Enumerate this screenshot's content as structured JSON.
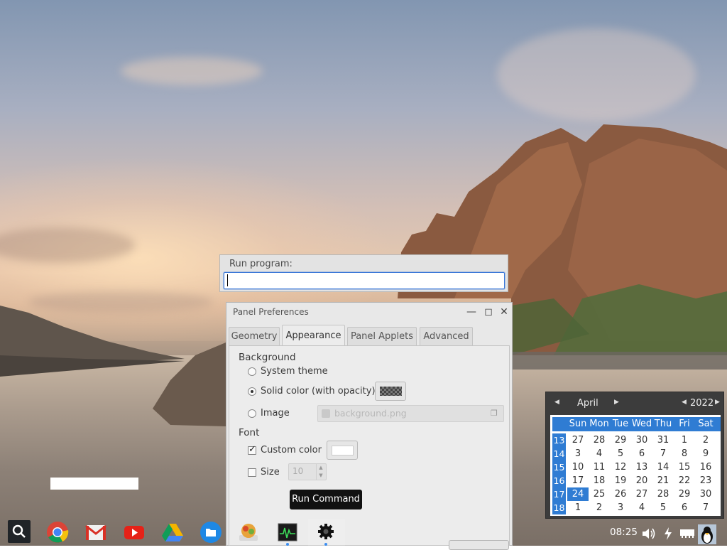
{
  "run_dialog": {
    "label": "Run program:",
    "value": ""
  },
  "prefs": {
    "title": "Panel Preferences",
    "tabs": [
      "Geometry",
      "Appearance",
      "Panel Applets",
      "Advanced"
    ],
    "active_tab": "Appearance",
    "background": {
      "heading": "Background",
      "options": [
        "System theme",
        "Solid color (with opacity)",
        "Image"
      ],
      "selected": "Solid color (with opacity)",
      "image_file": "background.png"
    },
    "font": {
      "heading": "Font",
      "custom_color_label": "Custom color",
      "custom_color_checked": true,
      "size_label": "Size",
      "size_checked": false,
      "size_value": "10"
    }
  },
  "tooltip": "Run Command",
  "calendar": {
    "month": "April",
    "year": "2022",
    "days_of_week": [
      "Sun",
      "Mon",
      "Tue",
      "Wed",
      "Thu",
      "Fri",
      "Sat"
    ],
    "weeks": [
      {
        "num": "13",
        "days": [
          "27",
          "28",
          "29",
          "30",
          "31",
          "1",
          "2"
        ]
      },
      {
        "num": "14",
        "days": [
          "3",
          "4",
          "5",
          "6",
          "7",
          "8",
          "9"
        ]
      },
      {
        "num": "15",
        "days": [
          "10",
          "11",
          "12",
          "13",
          "14",
          "15",
          "16"
        ]
      },
      {
        "num": "16",
        "days": [
          "17",
          "18",
          "19",
          "20",
          "21",
          "22",
          "23"
        ]
      },
      {
        "num": "17",
        "days": [
          "24",
          "25",
          "26",
          "27",
          "28",
          "29",
          "30"
        ]
      },
      {
        "num": "18",
        "days": [
          "1",
          "2",
          "3",
          "4",
          "5",
          "6",
          "7"
        ]
      }
    ],
    "today": "24"
  },
  "shelf": {
    "apps": [
      "search-icon",
      "chrome-icon",
      "gmail-icon",
      "youtube-icon",
      "drive-icon",
      "files-icon",
      "package-manager-icon",
      "system-monitor-icon",
      "settings-icon"
    ],
    "time": "08:25"
  },
  "colors": {
    "accent": "#2f7cd3",
    "calendar_bg": "#3c3c3c"
  }
}
